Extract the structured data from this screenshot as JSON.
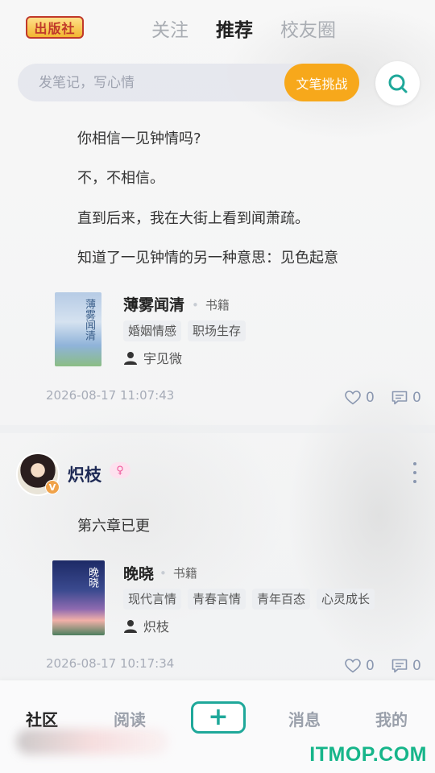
{
  "app": {
    "logo_text": "出版社"
  },
  "header": {
    "tabs": [
      {
        "label": "关注"
      },
      {
        "label": "推荐"
      },
      {
        "label": "校友圈"
      }
    ]
  },
  "search": {
    "placeholder": "发笔记，写心情",
    "challenge_label": "文笔挑战"
  },
  "post1": {
    "lines": [
      "你相信一见钟情吗?",
      "不，不相信。",
      "直到后来，我在大街上看到闻萧疏。",
      "知道了一见钟情的另一种意思：见色起意"
    ],
    "book": {
      "title": "薄雾闻清",
      "type": "书籍",
      "cover_text": "薄雾闻清",
      "tags": [
        "婚姻情感",
        "职场生存"
      ],
      "author": "宇见微"
    },
    "timestamp": "2026-08-17 11:07:43",
    "likes": "0",
    "comments": "0"
  },
  "post2": {
    "username": "炽枝",
    "gender_symbol": "♀",
    "verified_mark": "V",
    "text": "第六章已更",
    "book": {
      "title": "晚晓",
      "type": "书籍",
      "cover_text": "晚晓",
      "tags": [
        "现代言情",
        "青春言情",
        "青年百态",
        "心灵成长"
      ],
      "author": "炽枝"
    },
    "timestamp": "2026-08-17 10:17:34",
    "likes": "0",
    "comments": "0"
  },
  "bottom_nav": {
    "items": [
      {
        "label": "社区"
      },
      {
        "label": "阅读"
      },
      {
        "label": "消息"
      },
      {
        "label": "我的"
      }
    ],
    "add_symbol": "+"
  },
  "watermark": "ITMOP.COM",
  "colors": {
    "accent": "#1fa89a",
    "challenge": "#f7a81b",
    "username": "#1e2a55",
    "meta": "#a7acb8"
  }
}
